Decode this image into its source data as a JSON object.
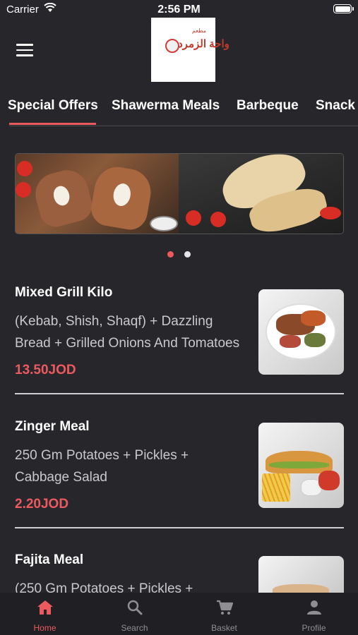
{
  "status_bar": {
    "carrier": "Carrier",
    "time": "2:56 PM"
  },
  "header": {
    "logo_text_ar": "واحة الزمرد",
    "logo_small_ar": "مطعم"
  },
  "tabs": [
    {
      "label": "Special Offers",
      "active": true
    },
    {
      "label": "Shawerma Meals",
      "active": false
    },
    {
      "label": "Barbeque",
      "active": false
    },
    {
      "label": "Snack & Sandwiches",
      "active": false
    }
  ],
  "carousel": {
    "page_count": 2,
    "active_page": 1
  },
  "items": [
    {
      "title": "Mixed Grill Kilo",
      "description": "(Kebab, Shish, Shaqf) + Dazzling Bread + Grilled Onions And Tomatoes",
      "price": "13.50JOD",
      "image": "mixed-grill-image"
    },
    {
      "title": "Zinger Meal",
      "description": "250 Gm Potatoes + Pickles + Cabbage Salad",
      "price": "2.20JOD",
      "image": "zinger-meal-image"
    },
    {
      "title": "Fajita Meal",
      "description": "(250 Gm Potatoes + Pickles +",
      "price": "",
      "image": "fajita-meal-image"
    }
  ],
  "bottom_nav": [
    {
      "label": "Home",
      "icon": "home-icon",
      "active": true
    },
    {
      "label": "Search",
      "icon": "search-icon",
      "active": false
    },
    {
      "label": "Basket",
      "icon": "cart-icon",
      "active": false
    },
    {
      "label": "Profile",
      "icon": "profile-icon",
      "active": false
    }
  ],
  "colors": {
    "background": "#27272b",
    "accent": "#ea5a5f",
    "nav_background": "#202024",
    "inactive": "#8e8e93"
  }
}
